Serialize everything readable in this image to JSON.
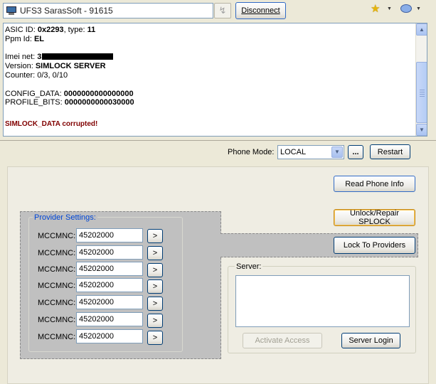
{
  "window": {
    "title": "UFS3 SarasSoft - 91615",
    "refresh_glyph": "↯",
    "disconnect_label": "Disconnect",
    "icons": {
      "app": "computer-icon",
      "star": "star-icon",
      "balloon": "balloon-icon"
    }
  },
  "log": {
    "asic_label": "ASIC ID: ",
    "asic_value": "0x2293",
    "asic_type_label": ", type: ",
    "asic_type_value": "11",
    "ppm_label": "Ppm Id: ",
    "ppm_value": "EL",
    "imei_label": "Imei net: ",
    "imei_visible": "3",
    "version_label": "Version: ",
    "version_value": "SIMLOCK SERVER",
    "counter_text": "Counter: 0/3, 0/10",
    "config_label": "CONFIG_DATA: ",
    "config_value": "0000000000000000",
    "profile_label": "PROFILE_BITS: ",
    "profile_value": "0000000000030000",
    "error_text": "SIMLOCK_DATA corrupted!",
    "error_color": "#800000"
  },
  "phone_mode": {
    "label": "Phone Mode:",
    "value": "LOCAL",
    "browse_label": "...",
    "restart_label": "Restart"
  },
  "actions": {
    "read_info_label": "Read Phone Info",
    "unlock_label": "Unlock/Repair SPLOCK",
    "lock_label": "Lock To Providers"
  },
  "provider": {
    "legend": "Provider Settings:",
    "rows": [
      {
        "label": "MCCMNC:",
        "value": "45202000",
        "button": ">"
      },
      {
        "label": "MCCMNC:",
        "value": "45202000",
        "button": ">"
      },
      {
        "label": "MCCMNC:",
        "value": "45202000",
        "button": ">"
      },
      {
        "label": "MCCMNC:",
        "value": "45202000",
        "button": ">"
      },
      {
        "label": "MCCMNC:",
        "value": "45202000",
        "button": ">"
      },
      {
        "label": "MCCMNC:",
        "value": "45202000",
        "button": ">"
      },
      {
        "label": "MCCMNC:",
        "value": "45202000",
        "button": ">"
      }
    ]
  },
  "server": {
    "legend": "Server:",
    "text": "",
    "activate_label": "Activate Access",
    "login_label": "Server Login"
  },
  "colors": {
    "window_bg": "#ece9d8",
    "legend_blue": "#0046d5",
    "gray_area": "#c0c0c0",
    "button_border": "#003c74"
  }
}
